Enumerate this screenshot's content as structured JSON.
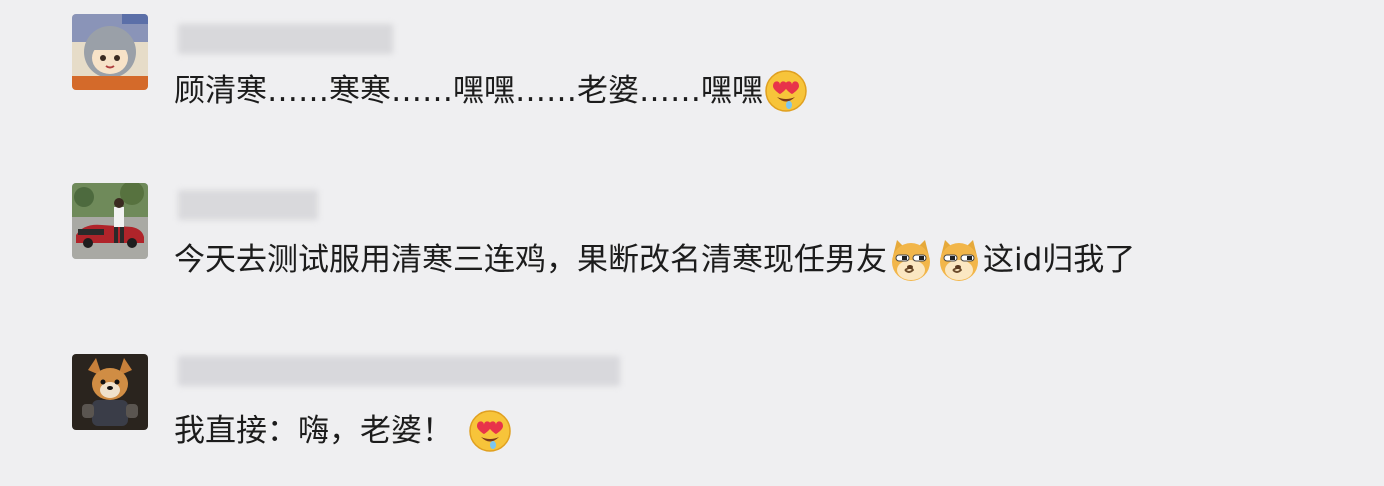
{
  "comments": [
    {
      "text_parts": [
        "顾清寒……寒寒……嘿嘿……老婆……嘿嘿"
      ],
      "emoji": [
        "heart-eyes-drool"
      ]
    },
    {
      "text_a": "今天去测试服用清寒三连鸡，果断改名清寒现任男友",
      "text_b": "这id归我了",
      "emoji": [
        "doge",
        "doge"
      ]
    },
    {
      "text_parts": [
        "我直接：嗨，老婆！"
      ],
      "emoji": [
        "heart-eyes-drool"
      ]
    }
  ],
  "colors": {
    "background": "#efeff1",
    "text": "#1c1c1c",
    "blur_name": "#d6d6d9"
  }
}
